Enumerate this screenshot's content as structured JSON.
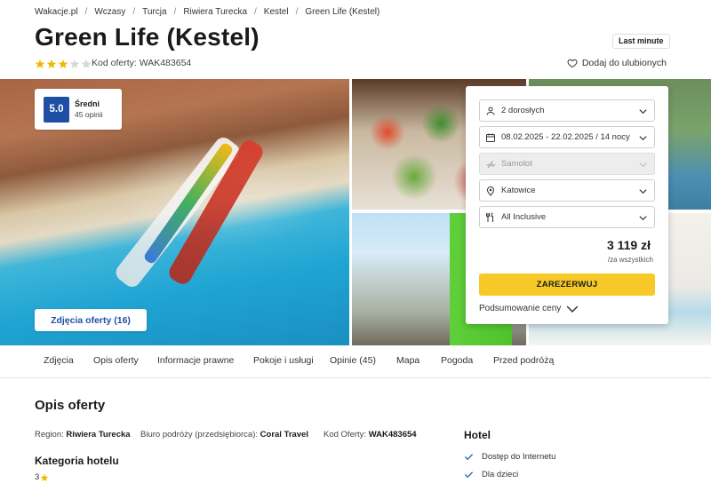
{
  "breadcrumb": [
    "Wakacje.pl",
    "Wczasy",
    "Turcja",
    "Riwiera Turecka",
    "Kestel",
    "Green Life (Kestel)"
  ],
  "title": "Green Life (Kestel)",
  "badge": "Last minute",
  "stars": {
    "filled": 3,
    "total": 5,
    "color": "#f5b800"
  },
  "offer_code": "Kod oferty: WAK483654",
  "favorite_label": "Dodaj do ulubionych",
  "rating": {
    "score": "5.0",
    "label": "Średni",
    "count": "45 opinii"
  },
  "photos_button": "Zdjęcia oferty (16)",
  "booking": {
    "guests": "2 dorosłych",
    "dates": "08.02.2025 - 22.02.2025 / 14 nocy",
    "transport": "Samolot",
    "departure": "Katowice",
    "board": "All Inclusive",
    "price": "3 119 zł",
    "price_note": "/za wszystkich",
    "book_label": "ZAREZERWUJ",
    "summary_label": "Podsumowanie ceny"
  },
  "tabs": [
    "Zdjęcia",
    "Opis oferty",
    "Informacje prawne",
    "Pokoje i usługi",
    "Opinie (45)",
    "Mapa",
    "Pogoda",
    "Przed podróżą"
  ],
  "description": {
    "title": "Opis oferty",
    "region_label": "Region:",
    "region_value": "Riwiera Turecka",
    "operator_label": "Biuro podróży (przedsiębiorca):",
    "operator_value": "Coral Travel",
    "code_label": "Kod Oferty:",
    "code_value": "WAK483654",
    "category_title": "Kategoria hotelu",
    "category_value": "3"
  },
  "hotel": {
    "title": "Hotel",
    "features": [
      "Dostęp do Internetu",
      "Dla dzieci"
    ]
  },
  "colors": {
    "brand_blue": "#1f4fa5",
    "cta_yellow": "#f7c928",
    "check_blue": "#2a6fb8"
  }
}
